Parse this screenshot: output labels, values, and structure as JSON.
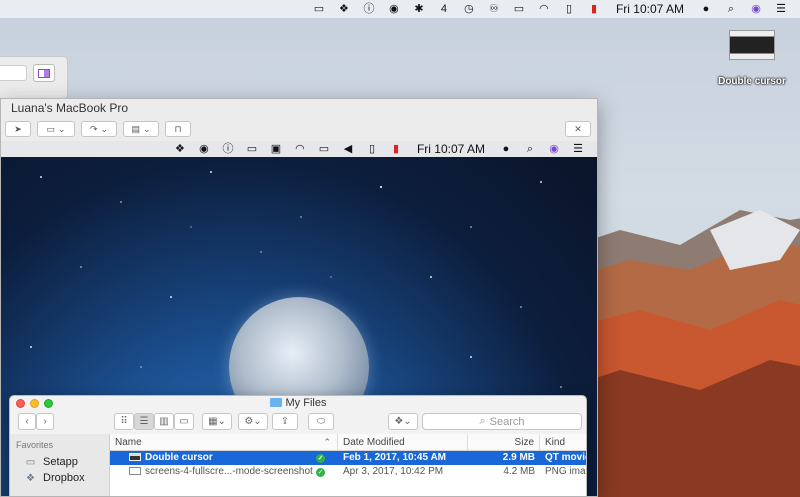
{
  "menubar": {
    "time": "Fri 10:07 AM",
    "icons": [
      "battery-status-icon",
      "dropbox-icon",
      "info-icon",
      "wifi-signal-icon",
      "bluetooth-icon",
      "calendar-icon",
      "clock-icon",
      "binoculars-icon",
      "airplay-icon",
      "wifi-icon",
      "battery-icon",
      "flag-icon",
      "user-icon",
      "search-icon",
      "siri-icon",
      "list-icon"
    ],
    "calendar_day": "4"
  },
  "desktop_icon": {
    "label": "Double cursor"
  },
  "remote_window": {
    "title": "Luana's MacBook Pro",
    "menubar_time": "Fri 10:07 AM"
  },
  "finder": {
    "title": "My Files",
    "search_placeholder": "Search",
    "sidebar": {
      "heading": "Favorites",
      "items": [
        {
          "label": "Setapp",
          "icon": "folder-icon"
        },
        {
          "label": "Dropbox",
          "icon": "dropbox-icon"
        }
      ]
    },
    "columns": {
      "name": "Name",
      "date": "Date Modified",
      "size": "Size",
      "kind": "Kind"
    },
    "files": [
      {
        "name": "Double cursor",
        "date": "Feb 1, 2017, 10:45 AM",
        "size": "2.9 MB",
        "kind": "QT movie",
        "selected": true
      },
      {
        "name": "screens-4-fullscre...-mode-screenshot",
        "date": "Apr 3, 2017, 10:42 PM",
        "size": "4.2 MB",
        "kind": "PNG image",
        "selected": false
      }
    ]
  },
  "colors": {
    "selection": "#1a68d8",
    "sync_check": "#2db34a",
    "accent_purple": "#8a4dbd"
  }
}
